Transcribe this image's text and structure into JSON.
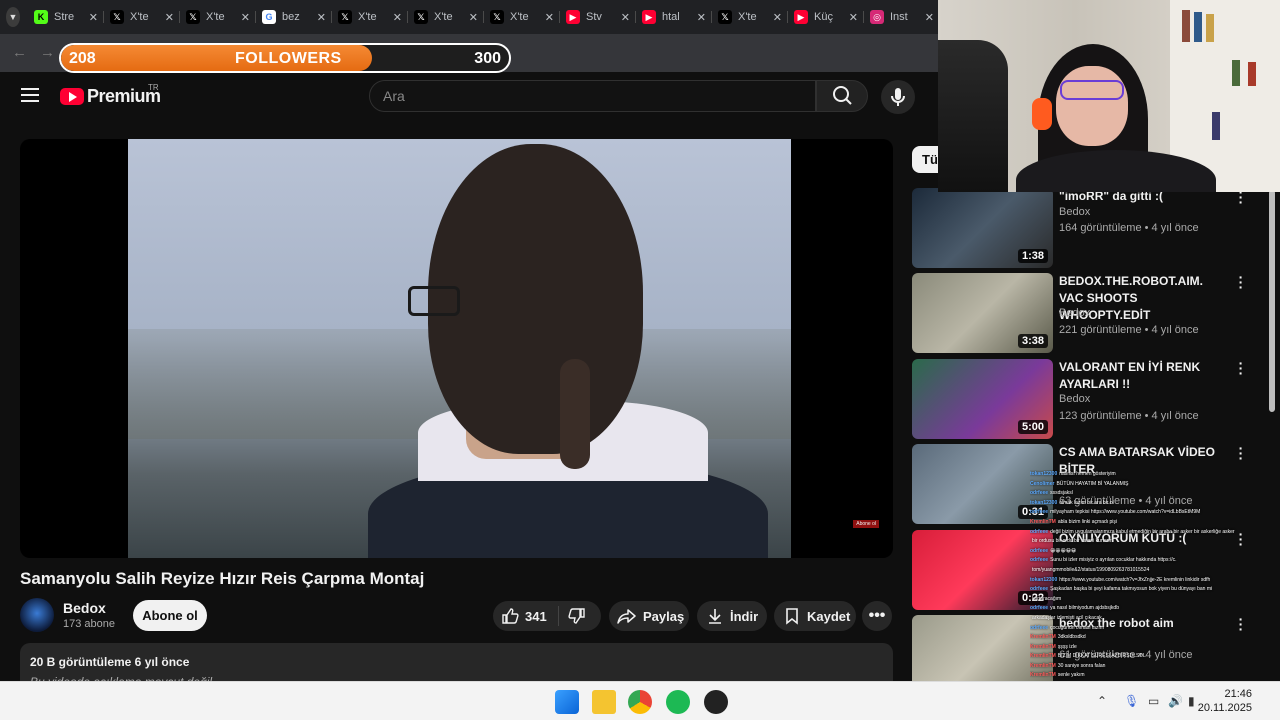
{
  "browser": {
    "tabs": [
      {
        "title": "Stre",
        "icon": "kick-icon",
        "color": "#53fc18",
        "glyph": "K"
      },
      {
        "title": "X'te",
        "icon": "x-logo-icon",
        "color": "#000000",
        "glyph": "𝕏"
      },
      {
        "title": "X'te",
        "icon": "x-logo-icon",
        "color": "#000000",
        "glyph": "𝕏"
      },
      {
        "title": "bez",
        "icon": "google-icon",
        "color": "#ffffff",
        "glyph": "G"
      },
      {
        "title": "X'te",
        "icon": "x-logo-icon",
        "color": "#000000",
        "glyph": "𝕏"
      },
      {
        "title": "X'te",
        "icon": "x-logo-icon",
        "color": "#000000",
        "glyph": "𝕏"
      },
      {
        "title": "X'te",
        "icon": "x-logo-icon",
        "color": "#000000",
        "glyph": "𝕏"
      },
      {
        "title": "Stv",
        "icon": "youtube-icon",
        "color": "#ff0033",
        "glyph": "▶"
      },
      {
        "title": "htal",
        "icon": "youtube-icon",
        "color": "#ff0033",
        "glyph": "▶"
      },
      {
        "title": "X'te",
        "icon": "x-logo-icon",
        "color": "#000000",
        "glyph": "𝕏"
      },
      {
        "title": "Küç",
        "icon": "youtube-icon",
        "color": "#ff0033",
        "glyph": "▶"
      },
      {
        "title": "Inst",
        "icon": "instagram-icon",
        "color": "#d62976",
        "glyph": "◎"
      }
    ]
  },
  "followers_goal": {
    "current": "208",
    "label": "FOLLOWERS",
    "target": "300",
    "progress": 0.6933
  },
  "header": {
    "logo_text": "Premium",
    "region": "TR",
    "search_placeholder": "Ara"
  },
  "video": {
    "title": "Samanyolu Salih Reyize Hızır Reis Çarpma Montaj",
    "overlay_badge": "Abone ol",
    "channel": {
      "name": "Bedox",
      "subscribers": "173 abone"
    },
    "subscribe_label": "Abone ol",
    "likes": "341",
    "share_label": "Paylaş",
    "download_label": "İndir",
    "save_label": "Kaydet",
    "description": {
      "stats": "20 B görüntüleme  6 yıl önce",
      "text": "Bu videoda açıklama mevcut değil"
    }
  },
  "sidebar": {
    "chip_label": "Tür",
    "recommendations": [
      {
        "title": "\"imoRR\" da gitti :(",
        "channel": "Bedox",
        "meta": "164 görüntüleme • 4 yıl önce",
        "duration": "1:38"
      },
      {
        "title": "BEDOX.THE.ROBOT.AIM. VAC SHOOTS WHOOPTY.EDİT",
        "channel": "Bedox",
        "meta": "221 görüntüleme • 4 yıl önce",
        "duration": "3:38"
      },
      {
        "title": "VALORANT EN İYİ RENK AYARLARI !!",
        "channel": "Bedox",
        "meta": "123 görüntüleme • 4 yıl önce",
        "duration": "5:00"
      },
      {
        "title": "CS AMA BATARSAK VİDEO BİTER",
        "channel": "",
        "meta": "63 görüntüleme • 4 yıl önce",
        "duration": "0:31"
      },
      {
        "title": "OYNUYORUM KÜTÜ :(",
        "channel": "",
        "meta": "",
        "duration": "0:22"
      },
      {
        "title": "bedox the robot aim",
        "channel": "",
        "meta": "61 görüntüleme • 4 yıl önce",
        "duration": ""
      }
    ]
  },
  "chat": {
    "lines": [
      {
        "user": "tokan12300",
        "color": "#5aa9ff",
        "text": "nasıllsı hemen gösteriyim"
      },
      {
        "user": "Cenolimer",
        "color": "#5aa9ff",
        "text": "BÜTÜN HAYATIM Bİ YALANMIŞ"
      },
      {
        "user": "odrfeee",
        "color": "#5aa9ff",
        "text": "sssdsjaksl"
      },
      {
        "user": "tokan12300",
        "color": "#5aa9ff",
        "text": "olmak lazım bir ara bir ol"
      },
      {
        "user": "odrfeee",
        "color": "#5aa9ff",
        "text": "milyayham tepkisi https://www.youtube.com/watch?v=idLbBsEtM9M"
      },
      {
        "user": "KremlinTM",
        "color": "#ff5a5a",
        "text": "abla bizim linki açmadı pişi"
      },
      {
        "user": "odrfeee",
        "color": "#5aa9ff",
        "text": "değil bizim uygulamalarımıza kabul etmediğin bir araba bir asker bir askerliğe asker"
      },
      {
        "user": "",
        "color": "#5aa9ff",
        "text": "bir ordusu bir ordu bir vatani kurtarır"
      },
      {
        "user": "odrfeee",
        "color": "#5aa9ff",
        "text": "😀😀😀😀😀"
      },
      {
        "user": "odrfeee",
        "color": "#5aa9ff",
        "text": "Sunu bi izler misiyiz o ayrılan cocuklar hakkında https://c."
      },
      {
        "user": "",
        "color": "#5aa9ff",
        "text": "tom/yuangmmobile&2/status/1990809263781015524"
      },
      {
        "user": "tokan12300",
        "color": "#5aa9ff",
        "text": "https://www.youtube.com/watch?v=JfxZnjje-2E kremlinin linkidir sdfh"
      },
      {
        "user": "odrfeee",
        "color": "#5aa9ff",
        "text": "Şaşkadan başka bi şeyi kafama takmıyosun bok yiyen bu dünyayı ban mi"
      },
      {
        "user": "",
        "color": "#5aa9ff",
        "text": "kurtaracağım"
      },
      {
        "user": "odrfeee",
        "color": "#5aa9ff",
        "text": "ya nasıl bilmiyodum ajdsbsjkdb"
      },
      {
        "user": "",
        "color": "#5aa9ff",
        "text": "arkadaşlar izlemişti acil çıkacak"
      },
      {
        "user": "odrfeee",
        "color": "#5aa9ff",
        "text": "çocuğunun olması lazım"
      },
      {
        "user": "KremlinTM",
        "color": "#ff5a5a",
        "text": "3dksldbsdkd"
      },
      {
        "user": "KremlinTM",
        "color": "#ff5a5a",
        "text": "şşşş izle"
      },
      {
        "user": "KremlinTM",
        "color": "#ff5a5a",
        "text": "BİZİM DİKKAT SÜRESİ AZDIRSDLSDL"
      },
      {
        "user": "KremlinTM",
        "color": "#ff5a5a",
        "text": "30 saniye sonra falan"
      },
      {
        "user": "KremlinTM",
        "color": "#ff5a5a",
        "text": "senle yakım"
      }
    ]
  },
  "taskbar": {
    "time": "21:46",
    "date": "20.11.2025"
  }
}
